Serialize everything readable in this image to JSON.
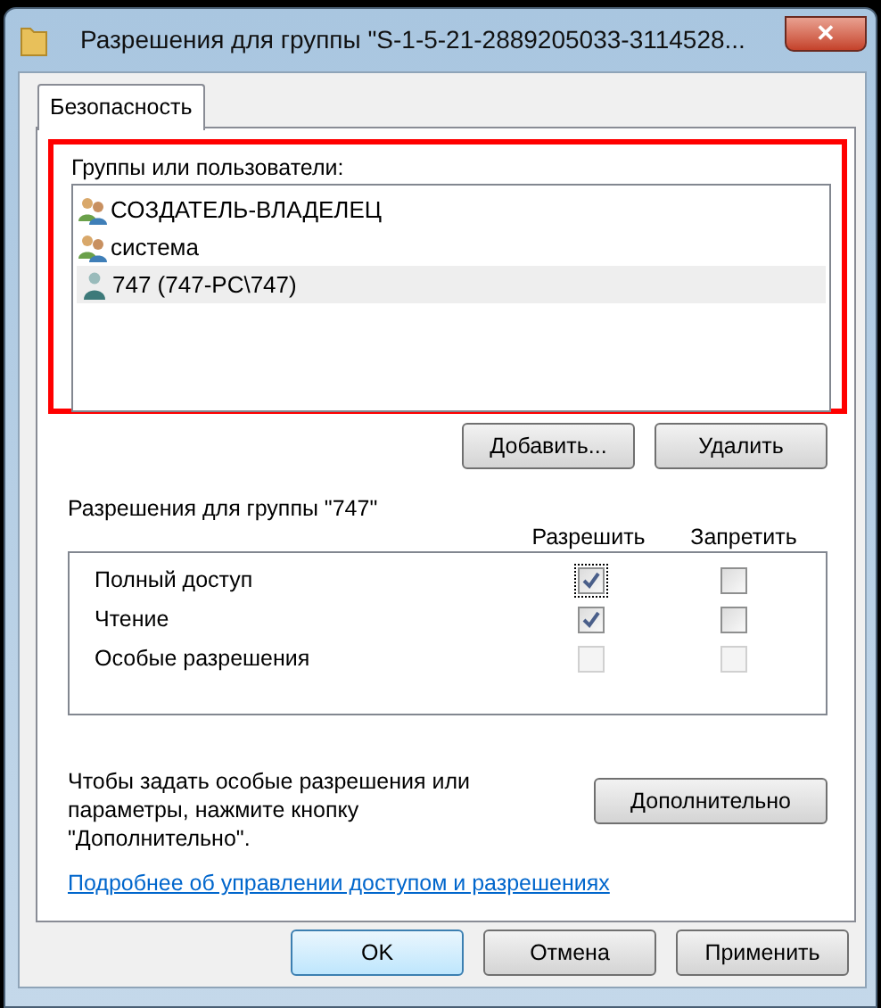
{
  "window": {
    "title": "Разрешения для группы \"S-1-5-21-2889205033-3114528...",
    "close": "✕"
  },
  "tabs": [
    {
      "label": "Безопасность",
      "selected": true
    }
  ],
  "groups": {
    "label": "Группы или пользователи:",
    "highlighted": true,
    "items": [
      {
        "name": "СОЗДАТЕЛЬ-ВЛАДЕЛЕЦ",
        "kind": "group",
        "selected": false
      },
      {
        "name": "система",
        "kind": "group",
        "selected": false
      },
      {
        "name": "747 (747-PC\\747)",
        "kind": "user",
        "selected": true
      }
    ],
    "buttons": [
      "Добавить...",
      "Удалить"
    ]
  },
  "permissions": {
    "label": "Разрешения для группы \"747\"",
    "columns": [
      "Разрешить",
      "Запретить"
    ],
    "rows": [
      {
        "name": "Полный доступ",
        "allow": {
          "checked": true,
          "disabled": false,
          "focused": true
        },
        "deny": {
          "checked": false,
          "disabled": false,
          "focused": false
        }
      },
      {
        "name": "Чтение",
        "allow": {
          "checked": true,
          "disabled": false,
          "focused": false
        },
        "deny": {
          "checked": false,
          "disabled": false,
          "focused": false
        }
      },
      {
        "name": "Особые разрешения",
        "allow": {
          "checked": false,
          "disabled": true,
          "focused": false
        },
        "deny": {
          "checked": false,
          "disabled": true,
          "focused": false
        }
      }
    ]
  },
  "advanced": {
    "text": "Чтобы задать особые разрешения или параметры, нажмите кнопку \"Дополнительно\".",
    "button": "Дополнительно"
  },
  "link": "Подробнее об управлении доступом и разрешениях",
  "footer_buttons": [
    {
      "label": "OK",
      "default": true
    },
    {
      "label": "Отмена",
      "default": false
    },
    {
      "label": "Применить",
      "default": false
    }
  ]
}
